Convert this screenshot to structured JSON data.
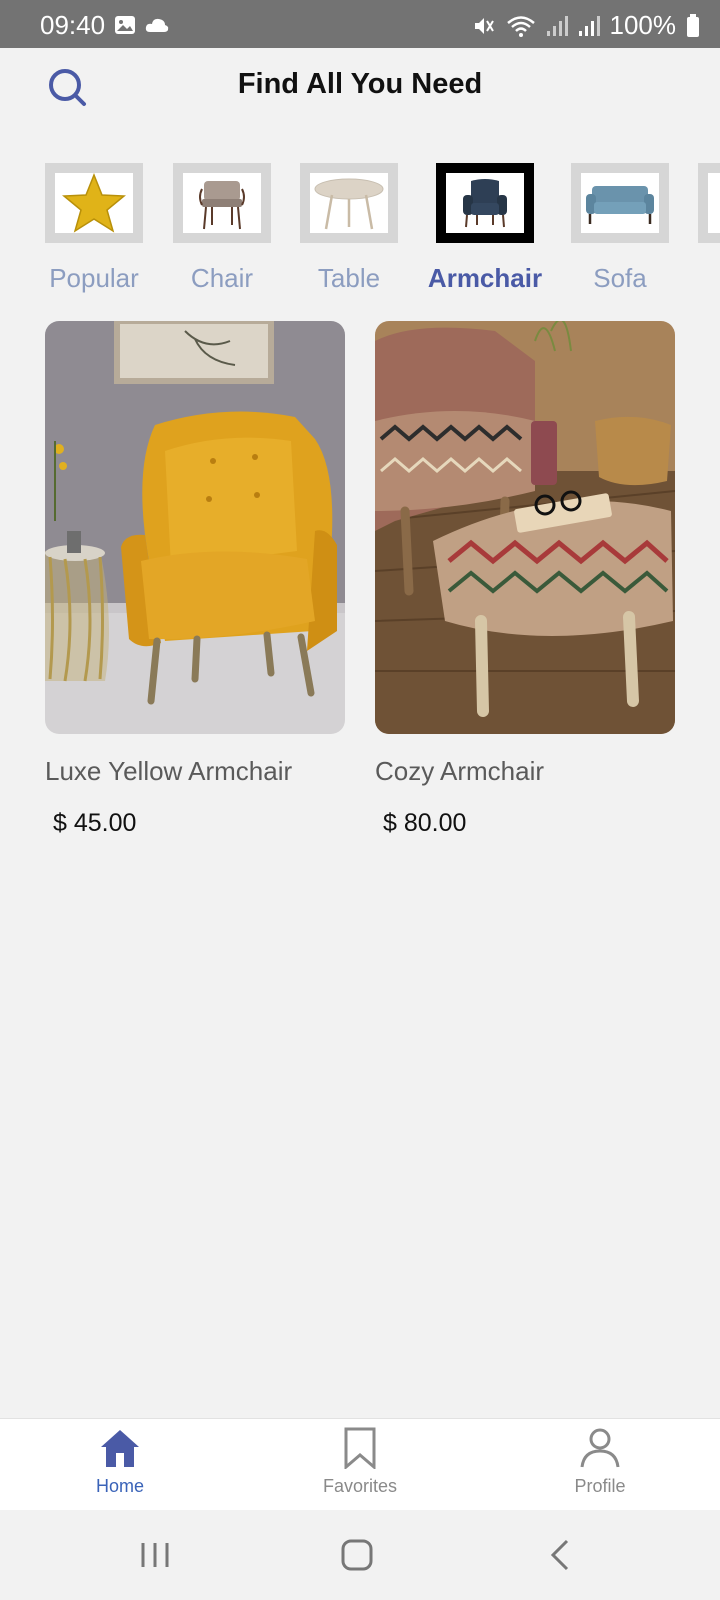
{
  "status_bar": {
    "time": "09:40",
    "battery": "100%",
    "icons": [
      "gallery-icon",
      "cloud-icon",
      "mute-icon",
      "wifi-icon",
      "signal-icon",
      "signal-icon",
      "battery-icon"
    ]
  },
  "header": {
    "title": "Find All You Need",
    "search_icon": "search-icon"
  },
  "categories": [
    {
      "label": "Popular",
      "icon": "star-image",
      "active": false
    },
    {
      "label": "Chair",
      "icon": "chair-image",
      "active": false
    },
    {
      "label": "Table",
      "icon": "table-image",
      "active": false
    },
    {
      "label": "Armchair",
      "icon": "armchair-image",
      "active": true
    },
    {
      "label": "Sofa",
      "icon": "sofa-image",
      "active": false
    },
    {
      "label": "",
      "icon": "partial-category-image",
      "active": false
    }
  ],
  "products": [
    {
      "name": "Luxe Yellow Armchair",
      "price": "$ 45.00",
      "image": "yellow-armchair-photo"
    },
    {
      "name": "Cozy Armchair",
      "price": "$ 80.00",
      "image": "patterned-armchair-photo"
    }
  ],
  "bottom_nav": [
    {
      "label": "Home",
      "icon": "home-icon",
      "active": true
    },
    {
      "label": "Favorites",
      "icon": "bookmark-icon",
      "active": false
    },
    {
      "label": "Profile",
      "icon": "person-icon",
      "active": false
    }
  ],
  "colors": {
    "accent": "#4a5aa6",
    "nav_active": "#3a63b8",
    "inactive_label": "#8c9dc0"
  }
}
